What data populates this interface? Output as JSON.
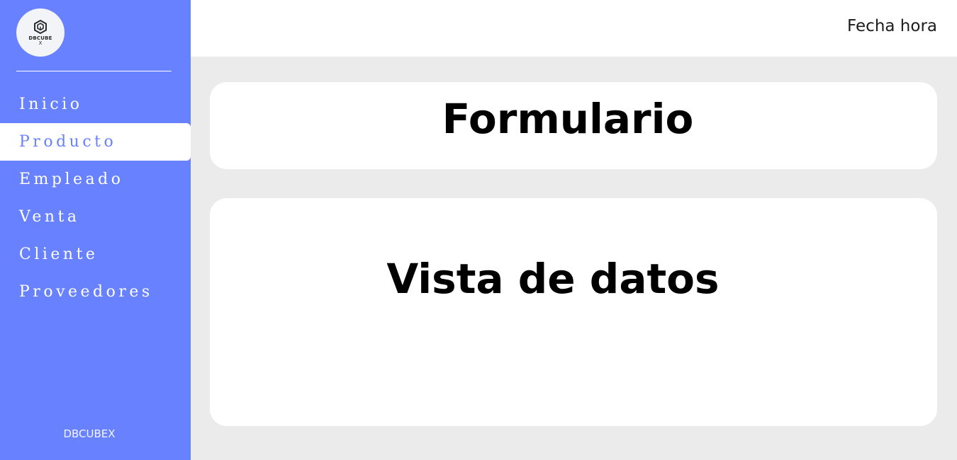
{
  "sidebar": {
    "logo": {
      "text": "DBCUBE",
      "sub": "X",
      "icon": "cube-logo-icon"
    },
    "items": [
      {
        "label": "Inicio",
        "active": false
      },
      {
        "label": "Producto",
        "active": true
      },
      {
        "label": "Empleado",
        "active": false
      },
      {
        "label": "Venta",
        "active": false
      },
      {
        "label": "Cliente",
        "active": false
      },
      {
        "label": "Proveedores",
        "active": false
      }
    ],
    "footer": "DBCUBEX"
  },
  "header": {
    "datetime": "Fecha hora"
  },
  "main": {
    "form_title": "Formulario",
    "view_title": "Vista de datos"
  },
  "colors": {
    "sidebar": "#6881fe",
    "background": "#ebebeb",
    "card": "#ffffff",
    "active_text": "#6881fe"
  }
}
